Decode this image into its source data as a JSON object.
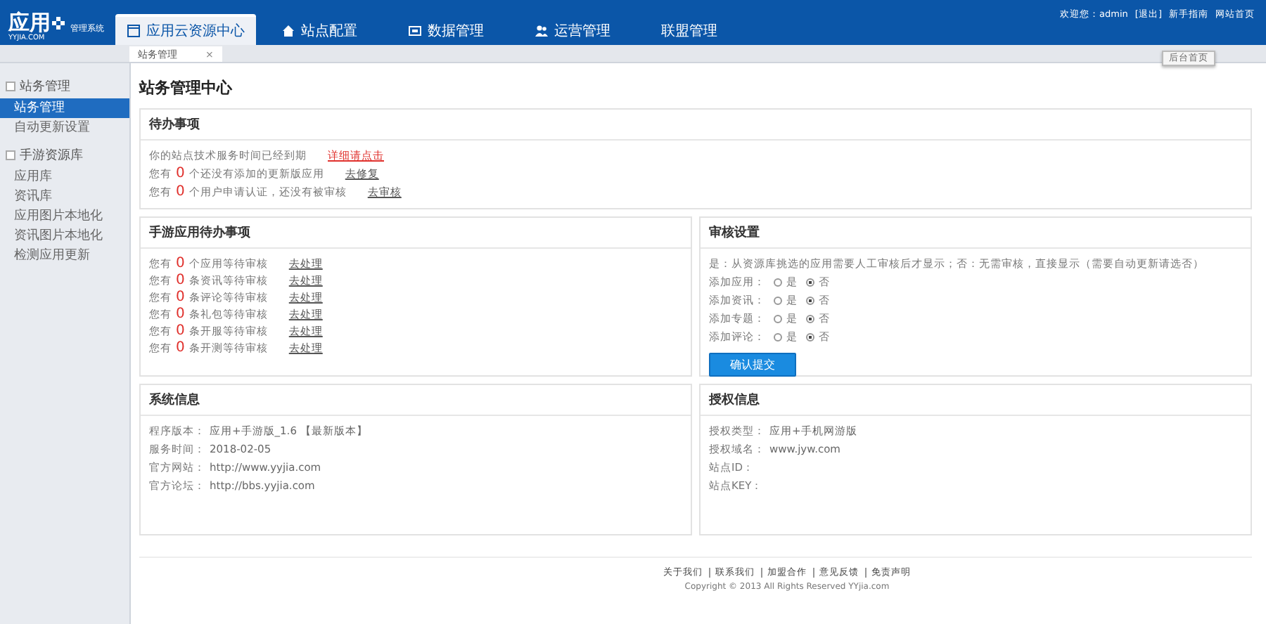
{
  "header": {
    "logo": "应用",
    "logo_sub": "YYJIA.COM",
    "system": "管理系统",
    "nav": [
      {
        "label": "应用云资源中心",
        "selected": true
      },
      {
        "label": "站点配置",
        "selected": false
      },
      {
        "label": "数据管理",
        "selected": false
      },
      {
        "label": "运营管理",
        "selected": false
      },
      {
        "label": "联盟管理",
        "selected": false
      }
    ],
    "welcome": "欢迎您：admin",
    "links": [
      "[退出]",
      "新手指南",
      "网站首页"
    ],
    "home_button": "后台首页"
  },
  "tabs": [
    {
      "label": "站务管理",
      "selected": true,
      "close": "×"
    }
  ],
  "sidebar": {
    "groups": [
      {
        "title": "站务管理",
        "items": [
          {
            "label": "站务管理",
            "selected": true
          },
          {
            "label": "自动更新设置",
            "selected": false
          }
        ]
      },
      {
        "title": "手游资源库",
        "items": [
          {
            "label": "应用库",
            "selected": false
          },
          {
            "label": "资讯库",
            "selected": false
          },
          {
            "label": "应用图片本地化",
            "selected": false
          },
          {
            "label": "资讯图片本地化",
            "selected": false
          },
          {
            "label": "检测应用更新",
            "selected": false
          }
        ]
      }
    ]
  },
  "page_title": "站务管理中心",
  "todo": {
    "title": "待办事项",
    "rows": [
      {
        "kind": "notice",
        "text": "你的站点技术服务时间已经到期",
        "link": "详细请点击"
      },
      {
        "kind": "count",
        "prefix": "您有",
        "count": "0",
        "text": "个还没有添加的更新版应用",
        "link": "去修复"
      },
      {
        "kind": "count",
        "prefix": "您有",
        "count": "0",
        "text": "个用户申请认证，还没有被审核",
        "link": "去审核"
      }
    ]
  },
  "game_todo": {
    "title": "手游应用待办事项",
    "rows": [
      {
        "kind": "count",
        "prefix": "您有",
        "count": "0",
        "text": "个应用等待审核",
        "link": "去处理"
      },
      {
        "kind": "count",
        "prefix": "您有",
        "count": "0",
        "text": "条资讯等待审核",
        "link": "去处理"
      },
      {
        "kind": "count",
        "prefix": "您有",
        "count": "0",
        "text": "条评论等待审核",
        "link": "去处理"
      },
      {
        "kind": "count",
        "prefix": "您有",
        "count": "0",
        "text": "条礼包等待审核",
        "link": "去处理"
      },
      {
        "kind": "count",
        "prefix": "您有",
        "count": "0",
        "text": "条开服等待审核",
        "link": "去处理"
      },
      {
        "kind": "count",
        "prefix": "您有",
        "count": "0",
        "text": "条开测等待审核",
        "link": "去处理"
      }
    ]
  },
  "review": {
    "title": "审核设置",
    "note": "是：从资源库挑选的应用需要人工审核后才显示；否：无需审核，直接显示（需要自动更新请选否）",
    "options": [
      {
        "label": "添加应用：",
        "choices": [
          {
            "label": "是",
            "selected": false
          },
          {
            "label": "否",
            "selected": true
          }
        ]
      },
      {
        "label": "添加资讯：",
        "choices": [
          {
            "label": "是",
            "selected": false
          },
          {
            "label": "否",
            "selected": true
          }
        ]
      },
      {
        "label": "添加专题：",
        "choices": [
          {
            "label": "是",
            "selected": false
          },
          {
            "label": "否",
            "selected": true
          }
        ]
      },
      {
        "label": "添加评论：",
        "choices": [
          {
            "label": "是",
            "selected": false
          },
          {
            "label": "否",
            "selected": true
          }
        ]
      }
    ],
    "submit": "确认提交"
  },
  "system_info": {
    "title": "系统信息",
    "lines": [
      {
        "label": "程序版本：",
        "value": "应用+手游版_1.6 【最新版本】"
      },
      {
        "label": "服务时间：",
        "value": "2018-02-05"
      },
      {
        "label": "官方网站：",
        "value": "http://www.yyjia.com"
      },
      {
        "label": "官方论坛：",
        "value": "http://bbs.yyjia.com"
      }
    ]
  },
  "license_info": {
    "title": "授权信息",
    "lines": [
      {
        "label": "授权类型：",
        "value": "应用+手机网游版"
      },
      {
        "label": "授权域名：",
        "value": "www.jyw.com"
      },
      {
        "label": "站点ID："
      },
      {
        "label": "站点KEY："
      }
    ]
  },
  "footer": {
    "links": [
      "关于我们",
      "联系我们",
      "加盟合作",
      "意见反馈",
      "免责声明"
    ],
    "copyright": "Copyright © 2013 All Rights Reserved YYjia.com"
  }
}
